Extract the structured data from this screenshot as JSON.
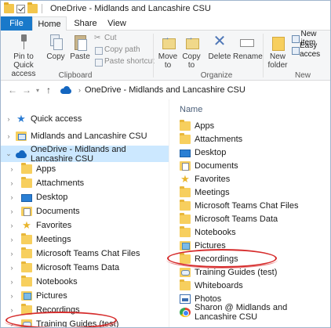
{
  "window": {
    "title": "OneDrive - Midlands and Lancashire CSU"
  },
  "tabs": [
    {
      "label": "File"
    },
    {
      "label": "Home"
    },
    {
      "label": "Share"
    },
    {
      "label": "View"
    }
  ],
  "ribbon": {
    "clipboard": {
      "pin_label_line1": "Pin to Quick",
      "pin_label_line2": "access",
      "copy_label": "Copy",
      "paste_label": "Paste",
      "cut_label": "Cut",
      "copy_path_label": "Copy path",
      "paste_shortcut_label": "Paste shortcut",
      "group_label": "Clipboard"
    },
    "organize": {
      "move_to_line1": "Move",
      "move_to_line2": "to",
      "copy_to_line1": "Copy",
      "copy_to_line2": "to",
      "delete_label": "Delete",
      "rename_label": "Rename",
      "group_label": "Organize"
    },
    "new": {
      "new_folder_line1": "New",
      "new_folder_line2": "folder",
      "new_item_label": "New item",
      "easy_access_label": "Easy acces",
      "group_label": "New"
    }
  },
  "address": {
    "location": "OneDrive - Midlands and Lancashire CSU"
  },
  "nav": {
    "items": [
      {
        "label": "Quick access",
        "icon": "star-icon"
      },
      {
        "label": "Midlands and Lancashire CSU",
        "icon": "shared-folder-icon"
      },
      {
        "label": "OneDrive - Midlands and Lancashire CSU",
        "icon": "cloud-icon"
      },
      {
        "label": "Apps",
        "icon": "folder-icon"
      },
      {
        "label": "Attachments",
        "icon": "folder-icon"
      },
      {
        "label": "Desktop",
        "icon": "desktop-icon"
      },
      {
        "label": "Documents",
        "icon": "documents-icon"
      },
      {
        "label": "Favorites",
        "icon": "star-icon"
      },
      {
        "label": "Meetings",
        "icon": "folder-icon"
      },
      {
        "label": "Microsoft Teams Chat Files",
        "icon": "folder-icon"
      },
      {
        "label": "Microsoft Teams Data",
        "icon": "folder-icon"
      },
      {
        "label": "Notebooks",
        "icon": "folder-icon"
      },
      {
        "label": "Pictures",
        "icon": "pictures-icon"
      },
      {
        "label": "Recordings",
        "icon": "folder-icon"
      },
      {
        "label": "Training Guides (test)",
        "icon": "shared-folder-icon"
      }
    ]
  },
  "content": {
    "column_header": "Name",
    "files": [
      {
        "label": "Apps",
        "icon": "folder-icon"
      },
      {
        "label": "Attachments",
        "icon": "folder-icon"
      },
      {
        "label": "Desktop",
        "icon": "desktop-icon"
      },
      {
        "label": "Documents",
        "icon": "documents-icon"
      },
      {
        "label": "Favorites",
        "icon": "star-icon"
      },
      {
        "label": "Meetings",
        "icon": "folder-icon"
      },
      {
        "label": "Microsoft Teams Chat Files",
        "icon": "folder-icon"
      },
      {
        "label": "Microsoft Teams Data",
        "icon": "folder-icon"
      },
      {
        "label": "Notebooks",
        "icon": "folder-icon"
      },
      {
        "label": "Pictures",
        "icon": "pictures-icon"
      },
      {
        "label": "Recordings",
        "icon": "folder-icon"
      },
      {
        "label": "Training Guides (test)",
        "icon": "shared-folder-icon"
      },
      {
        "label": "Whiteboards",
        "icon": "folder-icon"
      },
      {
        "label": "Photos",
        "icon": "photos-icon"
      },
      {
        "label": "Sharon @ Midlands and Lancashire CSU",
        "icon": "shared-location-icon"
      }
    ]
  },
  "colors": {
    "file_tab": "#1979ca",
    "selection": "#cce8ff",
    "annotation": "#d62c2c"
  }
}
